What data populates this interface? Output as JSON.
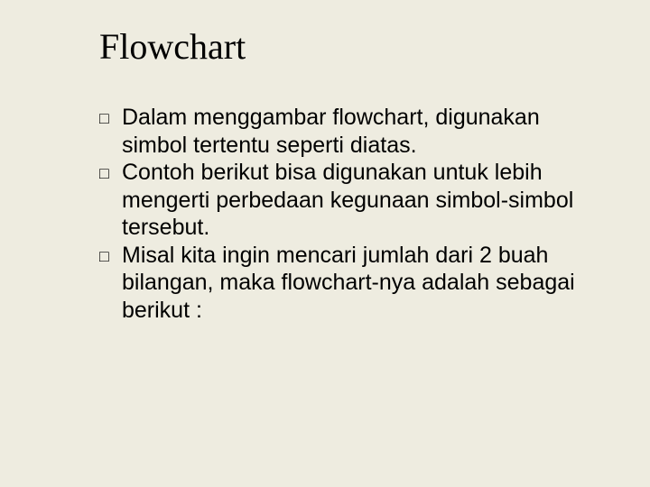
{
  "title": "Flowchart",
  "bullet_glyph": "□",
  "bullets": [
    {
      "text": "Dalam menggambar flowchart, digunakan simbol tertentu seperti diatas."
    },
    {
      "text": "Contoh berikut bisa digunakan untuk lebih mengerti perbedaan kegunaan simbol-simbol tersebut."
    },
    {
      "text": "Misal kita ingin mencari jumlah dari 2 buah bilangan, maka flowchart-nya adalah sebagai berikut :"
    }
  ]
}
